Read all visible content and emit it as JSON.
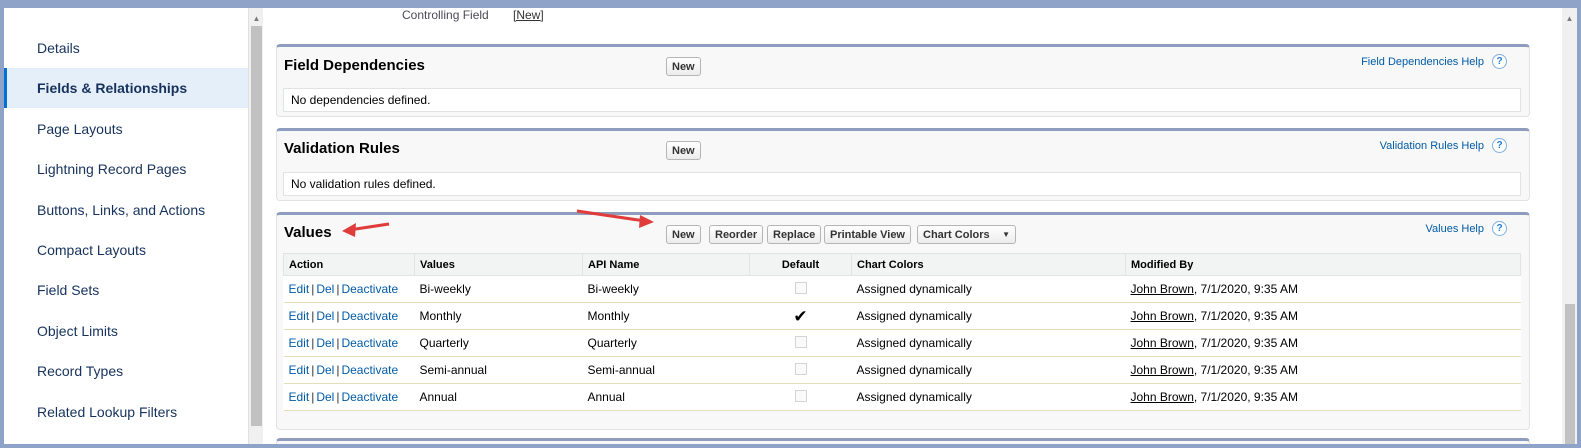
{
  "sidebar": {
    "items": [
      {
        "label": "Details"
      },
      {
        "label": "Fields & Relationships",
        "active": true
      },
      {
        "label": "Page Layouts"
      },
      {
        "label": "Lightning Record Pages"
      },
      {
        "label": "Buttons, Links, and Actions"
      },
      {
        "label": "Compact Layouts"
      },
      {
        "label": "Field Sets"
      },
      {
        "label": "Object Limits"
      },
      {
        "label": "Record Types"
      },
      {
        "label": "Related Lookup Filters"
      }
    ]
  },
  "controlling_field": {
    "label": "Controlling Field",
    "link": "[New]"
  },
  "field_dependencies": {
    "title": "Field Dependencies",
    "new_label": "New",
    "help_label": "Field Dependencies Help",
    "message": "No dependencies defined."
  },
  "validation_rules": {
    "title": "Validation Rules",
    "new_label": "New",
    "help_label": "Validation Rules Help",
    "message": "No validation rules defined."
  },
  "values_section": {
    "title": "Values",
    "buttons": {
      "new": "New",
      "reorder": "Reorder",
      "replace": "Replace",
      "printable_view": "Printable View",
      "chart_colors": "Chart Colors"
    },
    "help_label": "Values Help",
    "columns": [
      "Action",
      "Values",
      "API Name",
      "Default",
      "Chart Colors",
      "Modified By"
    ],
    "action_links": {
      "edit": "Edit",
      "del": "Del",
      "deactivate": "Deactivate",
      "sep": "|"
    },
    "rows": [
      {
        "value": "Bi-weekly",
        "api_name": "Bi-weekly",
        "default": false,
        "chart_color": "Assigned dynamically",
        "modified_user": "John Brown",
        "modified_date": ", 7/1/2020, 9:35 AM"
      },
      {
        "value": "Monthly",
        "api_name": "Monthly",
        "default": true,
        "chart_color": "Assigned dynamically",
        "modified_user": "John Brown",
        "modified_date": ", 7/1/2020, 9:35 AM"
      },
      {
        "value": "Quarterly",
        "api_name": "Quarterly",
        "default": false,
        "chart_color": "Assigned dynamically",
        "modified_user": "John Brown",
        "modified_date": ", 7/1/2020, 9:35 AM"
      },
      {
        "value": "Semi-annual",
        "api_name": "Semi-annual",
        "default": false,
        "chart_color": "Assigned dynamically",
        "modified_user": "John Brown",
        "modified_date": ", 7/1/2020, 9:35 AM"
      },
      {
        "value": "Annual",
        "api_name": "Annual",
        "default": false,
        "chart_color": "Assigned dynamically",
        "modified_user": "John Brown",
        "modified_date": ", 7/1/2020, 9:35 AM"
      }
    ]
  },
  "colors": {
    "accent": "#0070d2",
    "link": "#015ba7",
    "annotation_arrow": "#e03c3c",
    "block_border": "#8e9dbe"
  },
  "icons": {
    "help": "?",
    "dropdown": "▼",
    "check": "✔",
    "scroll_up": "▲"
  }
}
